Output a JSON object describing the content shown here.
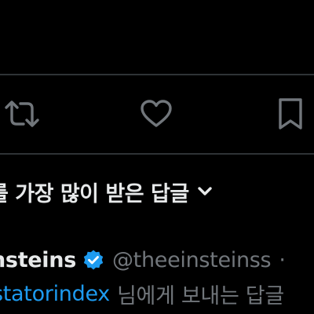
{
  "actions": {
    "retweet_icon": "retweet-icon",
    "like_icon": "heart-icon",
    "bookmark_icon": "bookmark-icon"
  },
  "sort": {
    "label": "를 가장 많이 받은 답글",
    "chevron_icon": "chevron-down-icon"
  },
  "reply": {
    "display_name": "nsteins",
    "verified_icon": "verified-badge-icon",
    "handle": "@theeinsteinss",
    "separator": "·",
    "mention": "statorindex",
    "replying_to_text": "님에게 보내는 답글"
  },
  "colors": {
    "background": "#000000",
    "divider": "#2f3336",
    "text_primary": "#e7e9ea",
    "text_secondary": "#71767b",
    "accent": "#1d9bf0"
  }
}
